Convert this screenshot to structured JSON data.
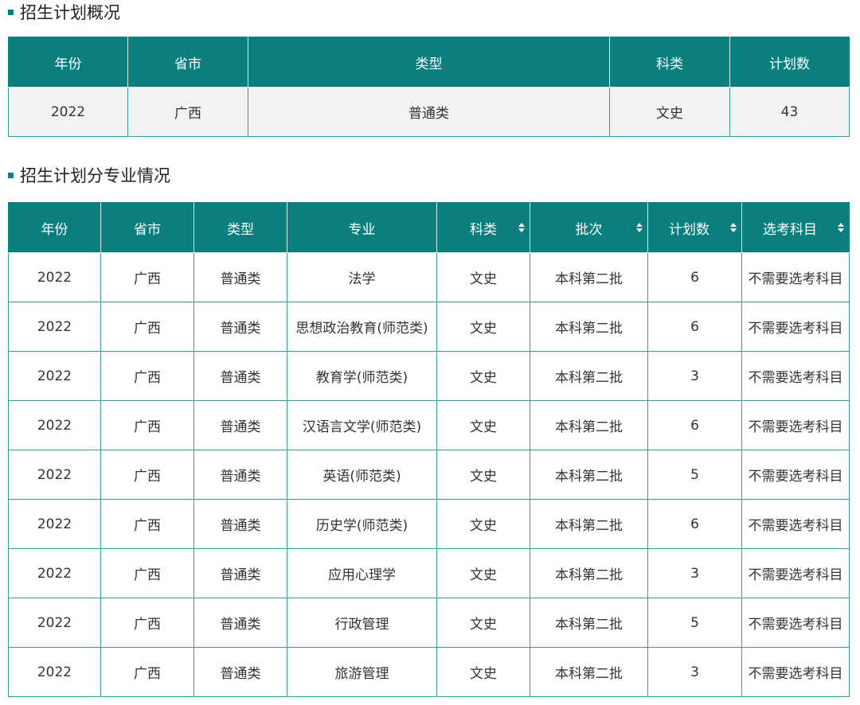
{
  "section1": {
    "title": "招生计划概况",
    "headers": [
      "年份",
      "省市",
      "类型",
      "科类",
      "计划数"
    ],
    "row": [
      "2022",
      "广西",
      "普通类",
      "文史",
      "43"
    ]
  },
  "section2": {
    "title": "招生计划分专业情况",
    "headers": [
      "年份",
      "省市",
      "类型",
      "专业",
      "科类",
      "批次",
      "计划数",
      "选考科目"
    ],
    "rows": [
      [
        "2022",
        "广西",
        "普通类",
        "法学",
        "文史",
        "本科第二批",
        "6",
        "不需要选考科目"
      ],
      [
        "2022",
        "广西",
        "普通类",
        "思想政治教育(师范类)",
        "文史",
        "本科第二批",
        "6",
        "不需要选考科目"
      ],
      [
        "2022",
        "广西",
        "普通类",
        "教育学(师范类)",
        "文史",
        "本科第二批",
        "3",
        "不需要选考科目"
      ],
      [
        "2022",
        "广西",
        "普通类",
        "汉语言文学(师范类)",
        "文史",
        "本科第二批",
        "6",
        "不需要选考科目"
      ],
      [
        "2022",
        "广西",
        "普通类",
        "英语(师范类)",
        "文史",
        "本科第二批",
        "5",
        "不需要选考科目"
      ],
      [
        "2022",
        "广西",
        "普通类",
        "历史学(师范类)",
        "文史",
        "本科第二批",
        "6",
        "不需要选考科目"
      ],
      [
        "2022",
        "广西",
        "普通类",
        "应用心理学",
        "文史",
        "本科第二批",
        "3",
        "不需要选考科目"
      ],
      [
        "2022",
        "广西",
        "普通类",
        "行政管理",
        "文史",
        "本科第二批",
        "5",
        "不需要选考科目"
      ],
      [
        "2022",
        "广西",
        "普通类",
        "旅游管理",
        "文史",
        "本科第二批",
        "3",
        "不需要选考科目"
      ]
    ]
  },
  "colors": {
    "header_bg": "#0b7e7e",
    "border": "#3a9a9a",
    "summary_row_bg": "#f2f2f2"
  }
}
